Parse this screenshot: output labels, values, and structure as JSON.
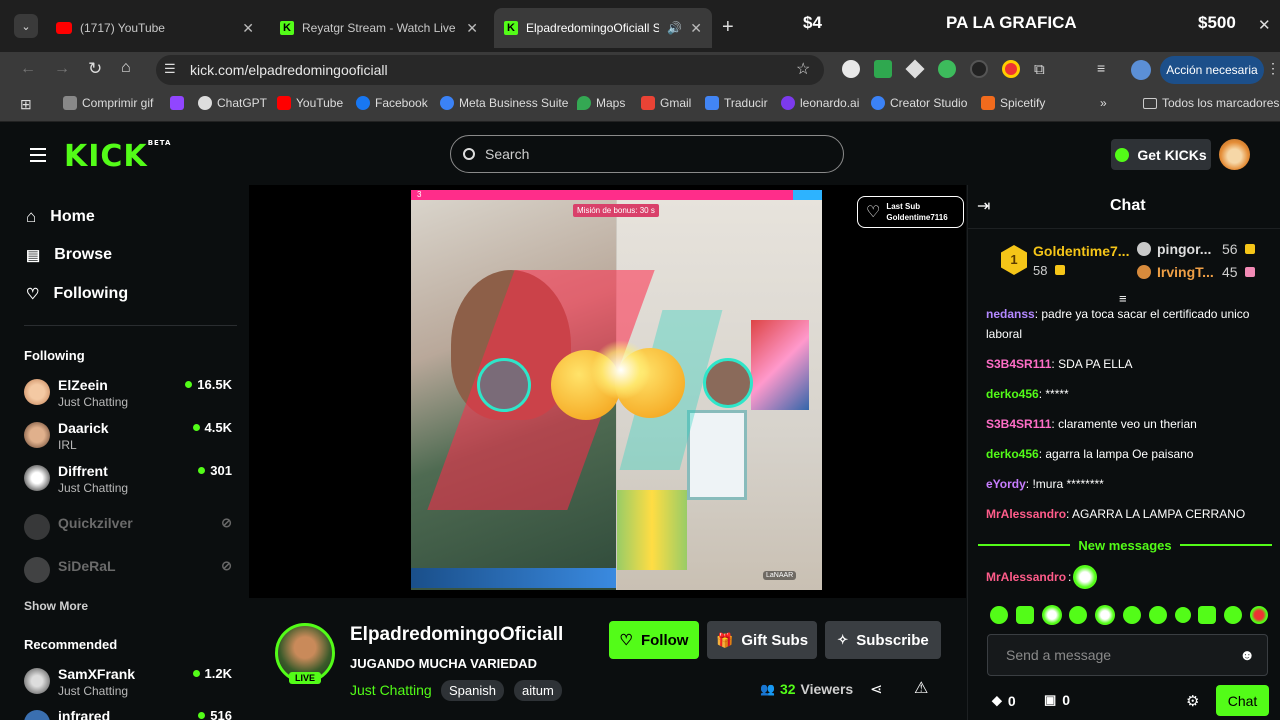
{
  "browser": {
    "tabs": [
      {
        "title": "(1717) YouTube",
        "color": "#ff0000"
      },
      {
        "title": "Reyatgr Stream - Watch Live on Kick",
        "color": "#53fc18"
      },
      {
        "title": "ElpadredomingoOficiall Stream",
        "color": "#53fc18"
      }
    ],
    "url": "kick.com/elpadredomingooficiall",
    "action_label": "Acción necesaria",
    "bookmarks": [
      "Comprimir gif",
      "ChatGPT",
      "YouTube",
      "Facebook",
      "Meta Business Suite",
      "Maps",
      "Gmail",
      "Traducir",
      "leonardo.ai",
      "Creator Studio",
      "Spicetify"
    ],
    "all_bookmarks": "Todos los marcadores"
  },
  "overlay": {
    "left": "$4",
    "center": "PA LA GRAFICA",
    "right": "$500"
  },
  "nav": {
    "home": "Home",
    "browse": "Browse",
    "following": "Following",
    "search_placeholder": "Search",
    "get_kicks": "Get KICKs"
  },
  "sidebar": {
    "following_title": "Following",
    "following": [
      {
        "name": "ElZeein",
        "category": "Just Chatting",
        "viewers": "16.5K",
        "live": true
      },
      {
        "name": "Daarick",
        "category": "IRL",
        "viewers": "4.5K",
        "live": true
      },
      {
        "name": "Diffrent",
        "category": "Just Chatting",
        "viewers": "301",
        "live": true
      },
      {
        "name": "Quickzilver",
        "category": "",
        "viewers": "",
        "live": false
      },
      {
        "name": "SiDeRaL",
        "category": "",
        "viewers": "",
        "live": false
      }
    ],
    "show_more": "Show More",
    "recommended_title": "Recommended",
    "recommended": [
      {
        "name": "SamXFrank",
        "category": "Just Chatting",
        "viewers": "1.2K"
      },
      {
        "name": "infrared",
        "category": "",
        "viewers": "516"
      }
    ]
  },
  "video": {
    "mission": "Misión de bonus: 30 s",
    "last_sub_label": "Last Sub",
    "last_sub_user": "Goldentime7116",
    "timer": "3",
    "corner": "LaNAAR"
  },
  "stream": {
    "channel": "ElpadredomingoOficiall",
    "title": "JUGANDO MUCHA VARIEDAD",
    "category": "Just Chatting",
    "tags": [
      "Spanish",
      "aitum"
    ],
    "live_badge": "LIVE",
    "follow": "Follow",
    "gift": "Gift Subs",
    "subscribe": "Subscribe",
    "viewers_count": "32",
    "viewers_label": "Viewers"
  },
  "chat": {
    "title": "Chat",
    "leaders": [
      {
        "rank": "1",
        "name": "Goldentime7...",
        "count": "58"
      },
      {
        "rank": "2",
        "name": "pingor...",
        "count": "56"
      },
      {
        "rank": "3",
        "name": "IrvingT...",
        "count": "45"
      }
    ],
    "messages": [
      {
        "user": "nedanss",
        "text": "padre ya toca sacar el certificado unico laboral",
        "color": "#b388ff"
      },
      {
        "user": "S3B4SR111",
        "text": "SDA PA ELLA",
        "color": "#ff6ec7"
      },
      {
        "user": "derko456",
        "text": "*****",
        "color": "#53fc18"
      },
      {
        "user": "S3B4SR111",
        "text": "claramente veo un therian",
        "color": "#ff6ec7"
      },
      {
        "user": "derko456",
        "text": "agarra la lampa Oe paisano",
        "color": "#53fc18"
      },
      {
        "user": "eYordy",
        "text": "!mura ********",
        "color": "#c77dff"
      },
      {
        "user": "MrAlessandro",
        "text": "AGARRA LA LAMPA CERRANO",
        "color": "#ff5c8a"
      }
    ],
    "new_messages": "New messages",
    "last_message_user": "MrAlessandro",
    "input_placeholder": "Send a message",
    "points": "0",
    "boxes": "0",
    "send": "Chat"
  },
  "colors": {
    "kick_green": "#53fc18",
    "bg": "#0b0e0f"
  }
}
